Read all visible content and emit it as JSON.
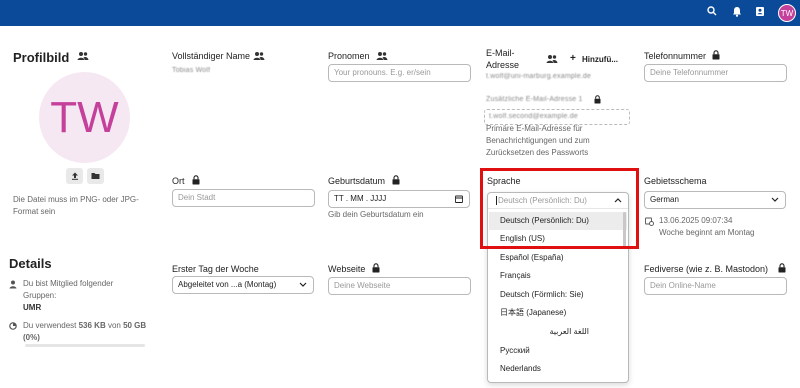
{
  "topbar": {
    "search_icon": "search-icon",
    "bell_icon": "bell-icon",
    "contacts_icon": "contacts-icon",
    "avatar_initials": "TW"
  },
  "profile_picture": {
    "title": "Profilbild",
    "avatar_initials": "TW",
    "hint": "Die Datei muss im PNG- oder JPG-Format sein"
  },
  "details": {
    "title": "Details",
    "groups_text": "Du bist Mitglied folgender Gruppen:",
    "group_name": "UMR",
    "usage_prefix": "Du verwendest ",
    "usage_used": "536 KB",
    "usage_mid": " von ",
    "usage_total": "50 GB",
    "usage_percent": "(0%)",
    "usage_fraction": 0
  },
  "full_name": {
    "label": "Vollständiger Name",
    "value": "Tobias Wolf"
  },
  "pronouns": {
    "label": "Pronomen",
    "placeholder": "Your pronouns. E.g. er/sein"
  },
  "email": {
    "label": "E-Mail-Adresse",
    "add_label": "Hinzufü...",
    "value1": "t.wolf@uni-marburg.example.de",
    "value2": "Zusätzliche E-Mail-Adresse 1",
    "value3": "t.wolf.second@example.de",
    "hint": "Primäre E-Mail-Adresse für Benachrichtigungen und zum Zurücksetzen des Passworts"
  },
  "phone": {
    "label": "Telefonnummer",
    "placeholder": "Deine Telefonnummer"
  },
  "location": {
    "label": "Ort",
    "placeholder": "Dein Stadt"
  },
  "birthdate": {
    "label": "Geburtsdatum",
    "value": "TT . MM . JJJJ",
    "hint": "Gib dein Geburtsdatum ein"
  },
  "language": {
    "label": "Sprache",
    "selected": "Deutsch (Persönlich: Du)",
    "options": [
      "Deutsch (Persönlich: Du)",
      "English (US)",
      "Español (España)",
      "Français",
      "Deutsch (Förmlich: Sie)",
      "日本語 (Japanese)",
      "اللغة العربية",
      "Русский",
      "Nederlands"
    ]
  },
  "locale": {
    "label": "Gebietsschema",
    "value": "German",
    "time": "13.06.2025 09:07:34",
    "week_start": "Woche beginnt am Montag"
  },
  "first_day": {
    "label": "Erster Tag der Woche",
    "value": "Abgeleitet von ...a (Montag)"
  },
  "website": {
    "label": "Webseite",
    "placeholder": "Deine Webseite"
  },
  "fediverse": {
    "label": "Fediverse (wie z. B. Mastodon)",
    "placeholder": "Dein Online-Name"
  },
  "colors": {
    "topbar": "#0a4a99",
    "avatar": "#c4409b",
    "highlight": "#e01010"
  }
}
